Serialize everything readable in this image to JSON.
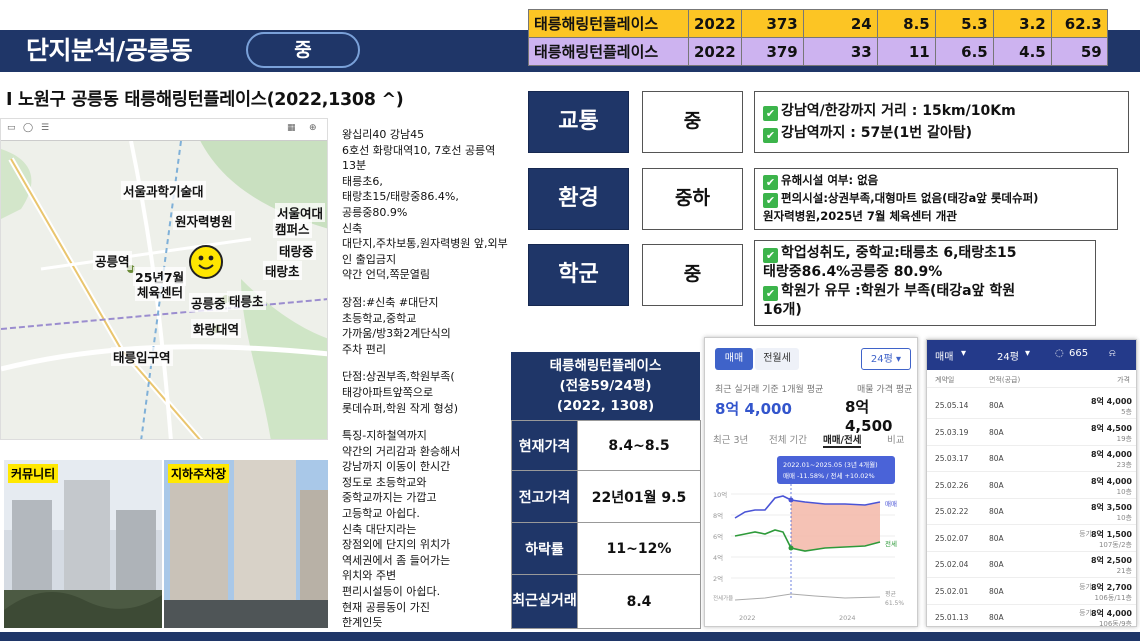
{
  "header": {
    "title": "단지분석/공릉동",
    "grade": "중"
  },
  "top_table": [
    {
      "name": "태릉해링턴플레이스",
      "year": "2022",
      "v1": "373",
      "v2": "24",
      "v3": "8.5",
      "v4": "5.3",
      "v5": "3.2",
      "v6": "62.3"
    },
    {
      "name": "태릉해링턴플레이스",
      "year": "2022",
      "v1": "379",
      "v2": "33",
      "v3": "11",
      "v4": "6.5",
      "v5": "4.5",
      "v6": "59"
    }
  ],
  "subtitle": "I 노원구 공릉동 태릉해링턴플레이스(2022,1308 ^)",
  "map": {
    "labels": [
      "서울과학기술대",
      "원자력병원",
      "서울여대",
      "캠퍼스",
      "태랑중",
      "태랑초",
      "공릉역",
      "25년7월",
      "체육센터",
      "공릉중",
      "태릉초",
      "화랑대역",
      "태릉입구역"
    ]
  },
  "photos": {
    "left_tag": "커뮤니티",
    "right_tag": "지하주차장"
  },
  "description": [
    "왕십리40 강남45",
    "6호선 화랑대역10, 7호선 공릉역 13분",
    "태릉초6,",
    "태랑초15/태랑중86.4%,",
    "공릉중80.9%",
    "신축",
    "대단지,주차보통,원자력병원 앞,외부인 출입금지",
    "약간 언덕,쪽문열림",
    "",
    "장점:#신축 #대단지",
    "초등학교,중학교",
    "가까움/방3화2계단식의",
    "주차 편리",
    "",
    "단점:상권부족,학원부족(",
    "태강아파트앞쪽으로",
    "롯데슈퍼,학원 작게 형성)",
    "",
    "특징-지하철역까지",
    "약간의 거리감과 환승해서",
    "강남까지 이동이 한시간",
    "정도로 초등학교와",
    "중학교까지는 가깝고",
    "고등학교 아쉽다.",
    "신축 대단지라는",
    "장점외에 단지의 위치가",
    "역세권에서 좀 들어가는",
    "위치와 주변",
    "편리시설등이 아쉽다.",
    "현재 공릉동이 가진",
    "한계인듯"
  ],
  "assessments": [
    {
      "category": "교통",
      "grade": "중",
      "details": [
        "강남역/한강까지 거리 : 15km/10Km",
        "강남역까지 : 57분(1번 갈아탐)"
      ]
    },
    {
      "category": "환경",
      "grade": "중하",
      "details": [
        "유해시설 여부: 없음",
        "편의시설:상권부족,대형마트 없음(태강a앞 롯데슈퍼)",
        "원자력병원,2025년 7월 체육센터 개관"
      ]
    },
    {
      "category": "학군",
      "grade": "중",
      "details": [
        "학업성취도, 중학교:태릉초 6,태랑초15",
        "태랑중86.4%공릉중 80.9%",
        "학원가 유무 :학원가 부족(태강a앞 학원",
        "16개)"
      ]
    }
  ],
  "summary": {
    "title_lines": [
      "태릉해링턴플레이스",
      "(전용59/24평)",
      "(2022, 1308)"
    ],
    "rows": [
      {
        "key": "현재가격",
        "value": "8.4~8.5"
      },
      {
        "key": "전고가격",
        "value": "22년01월 9.5"
      },
      {
        "key": "하락률",
        "value": "11~12%"
      },
      {
        "key": "최근실거래",
        "value": "8.4"
      }
    ]
  },
  "app1": {
    "tab_sale": "매매",
    "tab_jeonse": "전월세",
    "size": "24평",
    "recent_label": "최근 실거래 기준 1개월 평균",
    "recent_value": "8억 4,000",
    "avg_label": "매물 가격 평균",
    "avg_value": "8억 4,500",
    "subtabs": [
      "최근 3년",
      "전체 기간",
      "매매/전세",
      "비교"
    ],
    "tooltip_range": "2022.01~2025.05 (3년 4개월)",
    "tooltip_change": "매매 -11.58% / 전세 +10.02%",
    "y_labels": [
      "10억",
      "8억",
      "6억",
      "4억",
      "2억"
    ],
    "x_labels": [
      "2022",
      "2024"
    ],
    "legend": [
      "매매",
      "전세"
    ],
    "ratio_label": "평균",
    "ratio_value": "61.5%",
    "jeonse_rate": "전세가율",
    "chart_data": {
      "type": "line",
      "x": [
        "2022",
        "2024"
      ],
      "series": [
        {
          "name": "매매",
          "values": []
        },
        {
          "name": "전세",
          "values": []
        }
      ],
      "ylabel": "",
      "y_ticks": [
        "10억",
        "8억",
        "6억",
        "4억",
        "2억"
      ]
    }
  },
  "app2": {
    "tab": "매매",
    "size": "24평",
    "count": "665",
    "columns": [
      "계약일",
      "면적(공급)",
      "가격"
    ],
    "rows": [
      {
        "date": "25.05.14",
        "area": "80A",
        "price": "8억 4,000",
        "floor": "5층",
        "tag": ""
      },
      {
        "date": "25.03.19",
        "area": "80A",
        "price": "8억 4,500",
        "floor": "19층",
        "tag": ""
      },
      {
        "date": "25.03.17",
        "area": "80A",
        "price": "8억 4,000",
        "floor": "23층",
        "tag": ""
      },
      {
        "date": "25.02.26",
        "area": "80A",
        "price": "8억 4,000",
        "floor": "10층",
        "tag": ""
      },
      {
        "date": "25.02.22",
        "area": "80A",
        "price": "8억 3,500",
        "floor": "10층",
        "tag": ""
      },
      {
        "date": "25.02.07",
        "area": "80A",
        "price": "8억 1,500",
        "floor": "107동/2층",
        "tag": "등기"
      },
      {
        "date": "25.02.04",
        "area": "80A",
        "price": "8억 2,500",
        "floor": "21층",
        "tag": ""
      },
      {
        "date": "25.02.01",
        "area": "80A",
        "price": "8억 2,700",
        "floor": "106동/11층",
        "tag": "등기"
      },
      {
        "date": "25.01.13",
        "area": "80A",
        "price": "8억 4,000",
        "floor": "106동/9층",
        "tag": "등기"
      }
    ]
  },
  "colors": {
    "navy": "#1f3668",
    "yellow": "#fcc524",
    "lavender": "#cdb3f0",
    "check": "#3cb44b",
    "sale_line": "#4a54d6",
    "jeonse_line": "#2e9a3a"
  }
}
